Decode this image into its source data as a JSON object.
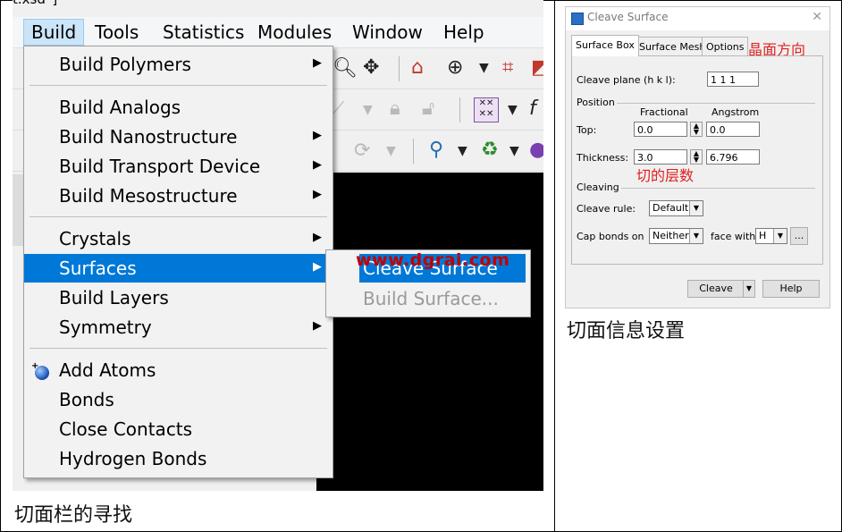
{
  "left_panel": {
    "title_fragment": "t.xsd*]",
    "menubar": [
      "Build",
      "Tools",
      "Statistics",
      "Modules",
      "Window",
      "Help"
    ],
    "build_menu": {
      "groups": [
        [
          {
            "label": "Build Polymers",
            "submenu": true
          }
        ],
        [
          {
            "label": "Build Analogs",
            "submenu": false
          },
          {
            "label": "Build Nanostructure",
            "submenu": true
          },
          {
            "label": "Build Transport Device",
            "submenu": true
          },
          {
            "label": "Build Mesostructure",
            "submenu": true
          }
        ],
        [
          {
            "label": "Crystals",
            "submenu": true
          },
          {
            "label": "Surfaces",
            "submenu": true,
            "highlighted": true
          },
          {
            "label": "Build Layers",
            "submenu": false
          },
          {
            "label": "Symmetry",
            "submenu": true
          }
        ],
        [
          {
            "label": "Add Atoms",
            "submenu": false,
            "icon": "add-atoms-icon"
          },
          {
            "label": "Bonds",
            "submenu": false
          },
          {
            "label": "Close Contacts",
            "submenu": false
          },
          {
            "label": "Hydrogen Bonds",
            "submenu": false
          }
        ]
      ]
    },
    "surfaces_submenu": [
      {
        "label": "Cleave Surface",
        "highlighted": true,
        "disabled": false
      },
      {
        "label": "Build Surface...",
        "highlighted": false,
        "disabled": true
      }
    ],
    "watermark": "www.dgrai.com",
    "caption": "切面栏的寻找"
  },
  "right_panel": {
    "dialog": {
      "title": "Cleave Surface",
      "tabs": [
        "Surface Box",
        "Surface Mesh",
        "Options"
      ],
      "active_tab": "Surface Box",
      "cleave_plane_label": "Cleave plane (h k l):",
      "cleave_plane_value": "1  1  1",
      "position_label": "Position",
      "col_fractional": "Fractional",
      "col_angstrom": "Angstrom",
      "top_label": "Top:",
      "top_fractional": "0.0",
      "top_angstrom": "0.0",
      "thickness_label": "Thickness:",
      "thickness_fractional": "3.0",
      "thickness_angstrom": "6.796",
      "cleaving_label": "Cleaving",
      "cleave_rule_label": "Cleave rule:",
      "cleave_rule_value": "Default",
      "cap_bonds_label": "Cap bonds on",
      "cap_bonds_value": "Neither",
      "face_with_label": "face with",
      "face_with_value": "H",
      "ellipsis_label": "...",
      "cleave_button": "Cleave",
      "help_button": "Help"
    },
    "annotations": {
      "crystal_direction": "晶面方向",
      "layer_count": "切的层数"
    },
    "caption": "切面信息设置"
  },
  "colors": {
    "menu_highlight": "#0078d7",
    "annotation_red": "#e02020",
    "watermark_red": "#c00000"
  }
}
